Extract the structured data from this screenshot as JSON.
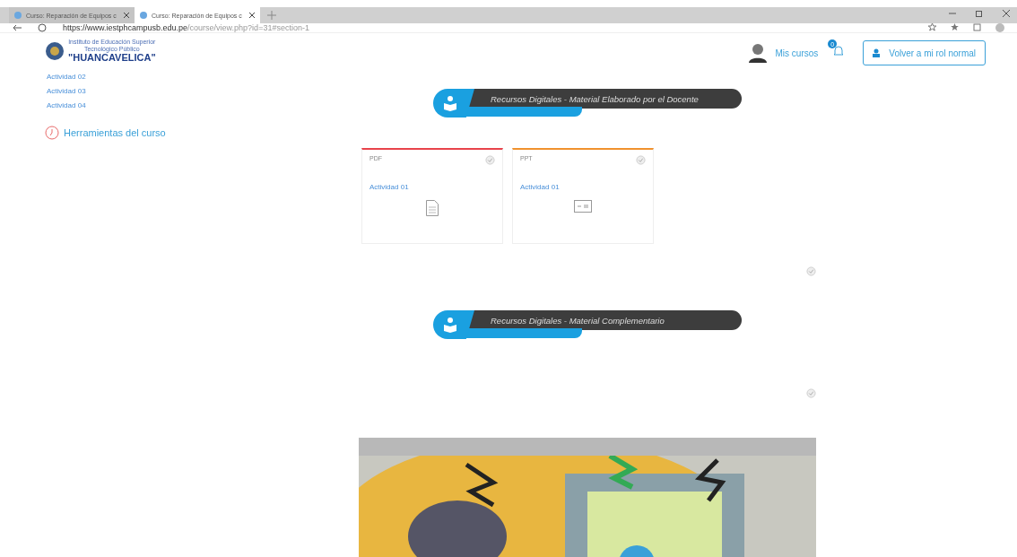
{
  "browser": {
    "tabs": [
      {
        "title": "Curso: Reparación de Equipos c",
        "selected": false
      },
      {
        "title": "Curso: Reparación de Equipos c",
        "selected": true
      }
    ],
    "url": {
      "host": "https://www.iestphcampusb.edu.pe",
      "path": "/course/view.php?id=31#section-1"
    }
  },
  "logo": {
    "line_1": "Instituto de Educación Superior",
    "line_2": "Tecnológico Público",
    "name": "\"HUANCAVELICA\""
  },
  "header": {
    "my_courses": "Mis cursos",
    "notifications": "0",
    "role_button": "Volver a mi rol normal"
  },
  "sidebar": {
    "activities": [
      "Actividad 02",
      "Actividad 03",
      "Actividad 04"
    ],
    "tools": "Herramientas del curso"
  },
  "sections": [
    {
      "title": "Recursos Digitales - Material Elaborado por el Docente",
      "cards": [
        {
          "type": "PDF",
          "name": "Actividad 01",
          "color": "#e8434b",
          "kind": "document"
        },
        {
          "type": "PPT",
          "name": "Actividad 01",
          "color": "#f0922e",
          "kind": "slides"
        }
      ]
    },
    {
      "title": "Recursos Digitales - Material Complementario"
    }
  ]
}
